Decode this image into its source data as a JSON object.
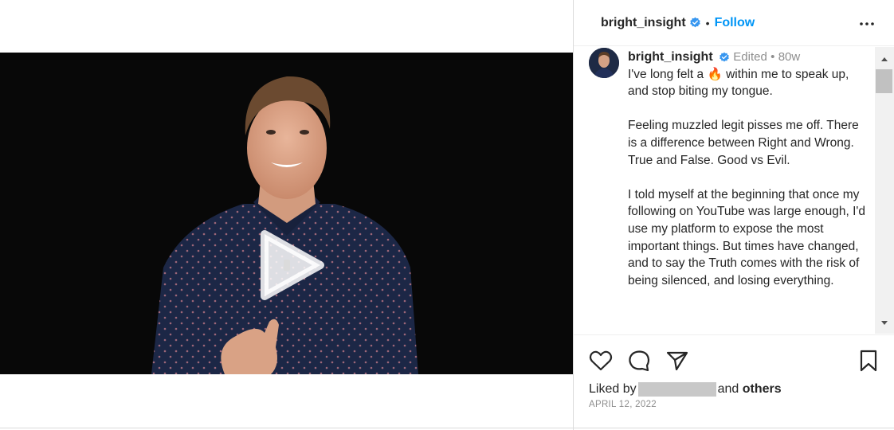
{
  "post": {
    "username": "bright_insight",
    "follow_label": "Follow",
    "separator": "•"
  },
  "caption": {
    "username": "bright_insight",
    "edited_label": "Edited",
    "meta_separator": "•",
    "age": "80w",
    "lines": [
      "I've long felt a",
      "within me to speak up, and stop biting my tongue.",
      "Feeling muzzled legit pisses me off. There is a difference between Right and Wrong. True and False. Good vs Evil.",
      "I told myself at the beginning that once my following on YouTube was large enough, I'd use my platform to expose the most important things. But times have changed, and to say the Truth comes with the risk of being silenced, and losing everything."
    ],
    "emoji": "🔥"
  },
  "likes": {
    "prefix": "Liked by",
    "connector": "and",
    "others": "others"
  },
  "date": "APRIL 12, 2022",
  "icons": {
    "verified": "verified-badge-icon",
    "more": "more-options-icon",
    "play": "play-icon",
    "mute": "muted-speaker-icon",
    "like": "heart-icon",
    "comment": "comment-bubble-icon",
    "share": "paper-plane-icon",
    "save": "bookmark-icon"
  },
  "colors": {
    "accent": "#0095f6",
    "verified": "#3897f0",
    "muted_text": "#8e8e8e",
    "video_bg": "#080808"
  }
}
